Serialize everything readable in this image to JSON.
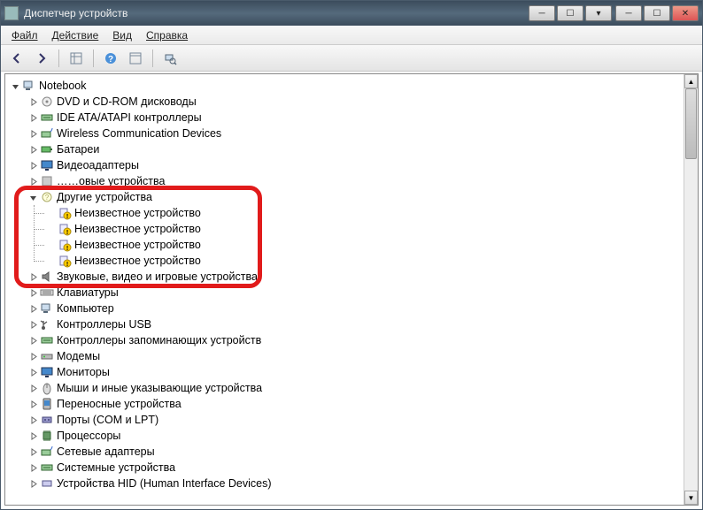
{
  "window": {
    "title": "Диспетчер устройств"
  },
  "menu": {
    "file": "Файл",
    "action": "Действие",
    "view": "Вид",
    "help": "Справка"
  },
  "toolbar_icons": {
    "back": "←",
    "forward": "→",
    "show_hidden": "⊞",
    "help": "?",
    "properties": "⊟",
    "scan": "⟳"
  },
  "tree": {
    "root": "Notebook",
    "categories": [
      {
        "label": "DVD и CD-ROM дисководы",
        "expanded": false,
        "icon": "optical-drive"
      },
      {
        "label": "IDE ATA/ATAPI контроллеры",
        "expanded": false,
        "icon": "controller"
      },
      {
        "label": "Wireless Communication Devices",
        "expanded": false,
        "icon": "wireless"
      },
      {
        "label": "Батареи",
        "expanded": false,
        "icon": "battery"
      },
      {
        "label": "Видеоадаптеры",
        "expanded": false,
        "icon": "display"
      },
      {
        "label": "……овые устройства",
        "expanded": false,
        "icon": "generic",
        "obscured": true
      },
      {
        "label": "Другие устройства",
        "expanded": true,
        "icon": "other-devices",
        "children": [
          {
            "label": "Неизвестное устройство",
            "icon": "unknown-device"
          },
          {
            "label": "Неизвестное устройство",
            "icon": "unknown-device"
          },
          {
            "label": "Неизвестное устройство",
            "icon": "unknown-device"
          },
          {
            "label": "Неизвестное устройство",
            "icon": "unknown-device"
          }
        ]
      },
      {
        "label": "Звуковые, видео и игровые устройства",
        "expanded": false,
        "icon": "sound",
        "obscured_partial": true
      },
      {
        "label": "Клавиатуры",
        "expanded": false,
        "icon": "keyboard"
      },
      {
        "label": "Компьютер",
        "expanded": false,
        "icon": "computer"
      },
      {
        "label": "Контроллеры USB",
        "expanded": false,
        "icon": "usb"
      },
      {
        "label": "Контроллеры запоминающих устройств",
        "expanded": false,
        "icon": "storage"
      },
      {
        "label": "Модемы",
        "expanded": false,
        "icon": "modem"
      },
      {
        "label": "Мониторы",
        "expanded": false,
        "icon": "monitor"
      },
      {
        "label": "Мыши и иные указывающие устройства",
        "expanded": false,
        "icon": "mouse"
      },
      {
        "label": "Переносные устройства",
        "expanded": false,
        "icon": "portable"
      },
      {
        "label": "Порты (COM и LPT)",
        "expanded": false,
        "icon": "port"
      },
      {
        "label": "Процессоры",
        "expanded": false,
        "icon": "cpu"
      },
      {
        "label": "Сетевые адаптеры",
        "expanded": false,
        "icon": "network"
      },
      {
        "label": "Системные устройства",
        "expanded": false,
        "icon": "system"
      },
      {
        "label": "Устройства HID (Human Interface Devices)",
        "expanded": false,
        "icon": "hid",
        "cutoff": true
      }
    ]
  },
  "annotation": {
    "highlight_category": "Другие устройства",
    "color": "#e11b1b"
  }
}
